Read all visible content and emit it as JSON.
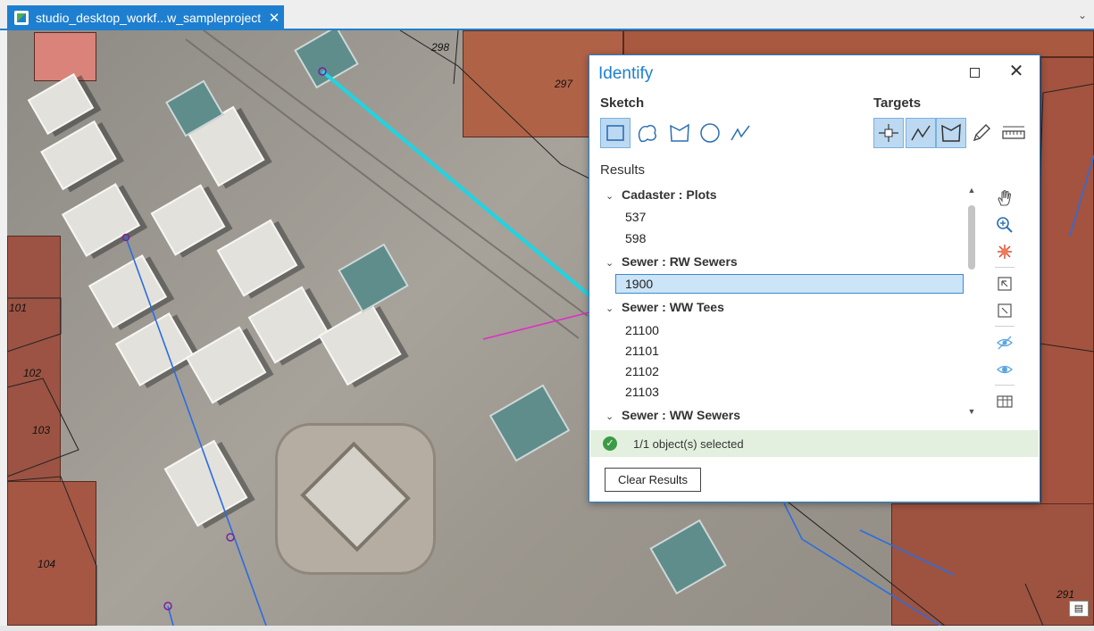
{
  "tab": {
    "title": "studio_desktop_workf...w_sampleproject",
    "close": "✕",
    "menu": "⌄"
  },
  "map": {
    "parcel_labels": [
      "298",
      "297",
      "101",
      "102",
      "103",
      "104",
      "291"
    ]
  },
  "identify": {
    "title": "Identify",
    "maximize_icon": "maximize-icon",
    "close_label": "✕",
    "sketch_label": "Sketch",
    "targets_label": "Targets",
    "results_label": "Results",
    "groups": [
      {
        "title": "Cadaster : Plots",
        "items": [
          "537",
          "598"
        ]
      },
      {
        "title": "Sewer : RW Sewers",
        "items": [
          "1900"
        ]
      },
      {
        "title": "Sewer : WW Tees",
        "items": [
          "21100",
          "21101",
          "21102",
          "21103"
        ]
      },
      {
        "title": "Sewer : WW Sewers",
        "items": []
      }
    ],
    "selected_item": "1900",
    "status_text": "1/1 object(s) selected",
    "clear_button": "Clear Results",
    "colors": {
      "accent": "#1e7fd0",
      "selection": "#cce4f7",
      "status_bg": "#e4f0df",
      "ok": "#3c9b46"
    }
  }
}
